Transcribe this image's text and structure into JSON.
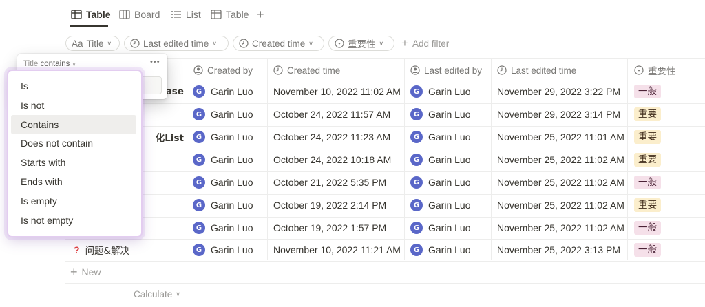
{
  "views": [
    {
      "label": "Table",
      "icon": "table-icon",
      "active": true
    },
    {
      "label": "Board",
      "icon": "board-icon",
      "active": false
    },
    {
      "label": "List",
      "icon": "list-icon",
      "active": false
    },
    {
      "label": "Table",
      "icon": "table-icon",
      "active": false
    }
  ],
  "add_view_label": "+",
  "filters": [
    {
      "prefix": "Aa",
      "label": "Title"
    },
    {
      "label": "Last edited time",
      "icon": "clock-icon"
    },
    {
      "label": "Created time",
      "icon": "clock-icon"
    },
    {
      "label": "重要性",
      "icon": "select-icon"
    }
  ],
  "add_filter_label": "Add filter",
  "filter_popover": {
    "property": "Title",
    "operator": "contains",
    "more_label": "•••"
  },
  "filter_options": [
    "Is",
    "Is not",
    "Contains",
    "Does not contain",
    "Starts with",
    "Ends with",
    "Is empty",
    "Is not empty"
  ],
  "selected_option": "Contains",
  "columns": {
    "created_by": "Created by",
    "created_time": "Created time",
    "last_edited_by": "Last edited by",
    "last_edited_time": "Last edited time",
    "importance": "重要性"
  },
  "rows": [
    {
      "title": "ase",
      "title_icon": "",
      "created_by": "Garin Luo",
      "created_time": "November 10, 2022 11:02 AM",
      "last_edited_by": "Garin Luo",
      "last_edited_time": "November 29, 2022 3:22 PM",
      "importance": "一般"
    },
    {
      "title": "",
      "title_icon": "",
      "created_by": "Garin Luo",
      "created_time": "October 24, 2022 11:57 AM",
      "last_edited_by": "Garin Luo",
      "last_edited_time": "November 29, 2022 3:14 PM",
      "importance": "重要"
    },
    {
      "title": "化List",
      "title_icon": "",
      "created_by": "Garin Luo",
      "created_time": "October 24, 2022 11:23 AM",
      "last_edited_by": "Garin Luo",
      "last_edited_time": "November 25, 2022 11:01 AM",
      "importance": "重要"
    },
    {
      "title": "",
      "title_icon": "",
      "created_by": "Garin Luo",
      "created_time": "October 24, 2022 10:18 AM",
      "last_edited_by": "Garin Luo",
      "last_edited_time": "November 25, 2022 11:02 AM",
      "importance": "重要"
    },
    {
      "title": "",
      "title_icon": "",
      "created_by": "Garin Luo",
      "created_time": "October 21, 2022 5:35 PM",
      "last_edited_by": "Garin Luo",
      "last_edited_time": "November 25, 2022 11:02 AM",
      "importance": "一般"
    },
    {
      "title": "",
      "title_icon": "",
      "created_by": "Garin Luo",
      "created_time": "October 19, 2022 2:14 PM",
      "last_edited_by": "Garin Luo",
      "last_edited_time": "November 25, 2022 11:02 AM",
      "importance": "重要"
    },
    {
      "title": "",
      "title_icon": "",
      "created_by": "Garin Luo",
      "created_time": "October 19, 2022 1:57 PM",
      "last_edited_by": "Garin Luo",
      "last_edited_time": "November 25, 2022 11:02 AM",
      "importance": "一般"
    },
    {
      "title": "问题&解决",
      "title_icon": "?",
      "created_by": "Garin Luo",
      "created_time": "November 10, 2022 11:21 AM",
      "last_edited_by": "Garin Luo",
      "last_edited_time": "November 25, 2022 3:13 PM",
      "importance": "一般"
    }
  ],
  "avatar_initial": "G",
  "new_row_label": "New",
  "calculate_label": "Calculate",
  "colors": {
    "tag_normal_bg": "#f5e0e9",
    "tag_important_bg": "#fbeecc",
    "avatar_bg": "#5a67c8",
    "dropdown_border": "#e3cdf0"
  }
}
